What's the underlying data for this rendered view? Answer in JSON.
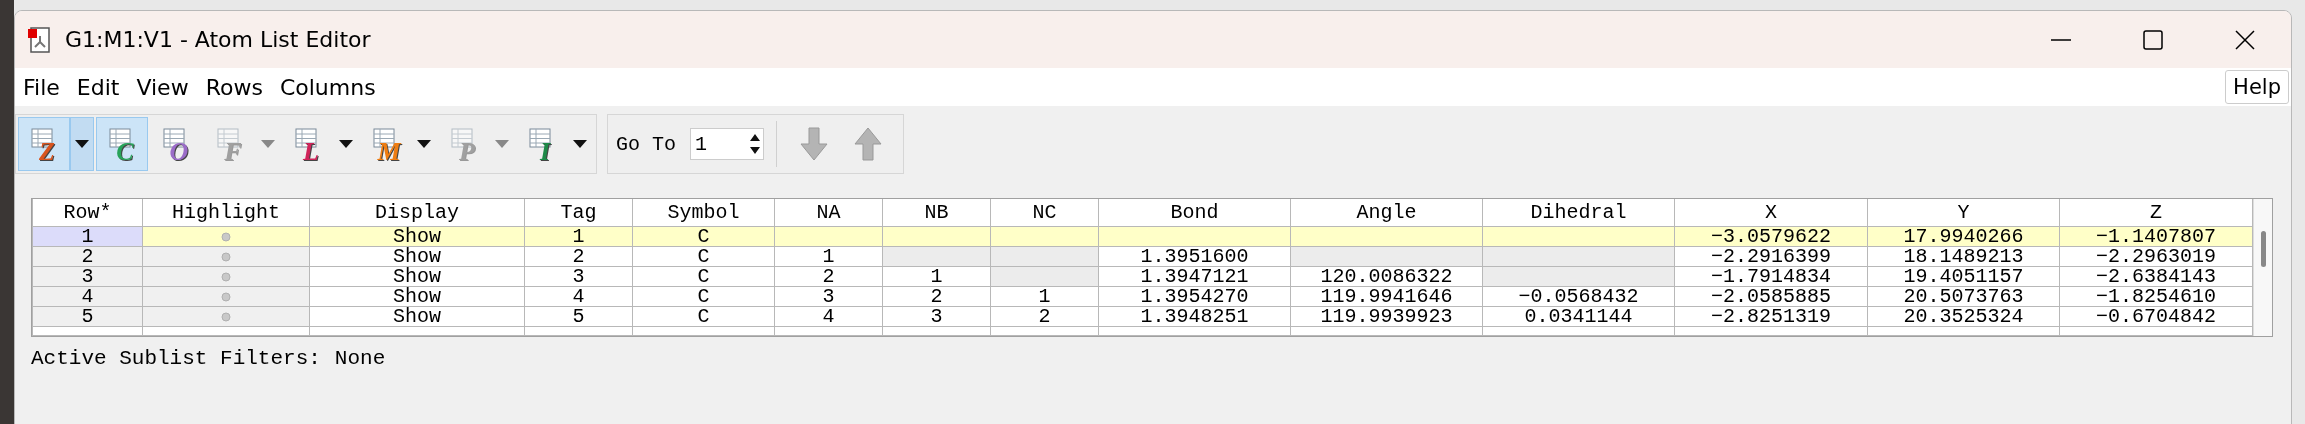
{
  "window": {
    "title": "G1:M1:V1 - Atom List Editor"
  },
  "menu": {
    "items": [
      "File",
      "Edit",
      "View",
      "Rows",
      "Columns"
    ],
    "help": "Help"
  },
  "toolbar": {
    "buttons": [
      {
        "letter": "Z",
        "color": "#d9541e",
        "selected": true,
        "disabled": false,
        "dropdown": true
      },
      {
        "letter": "C",
        "color": "#27a35a",
        "selected": true,
        "disabled": false,
        "dropdown": false
      },
      {
        "letter": "O",
        "color": "#9b6cc8",
        "selected": false,
        "disabled": false,
        "dropdown": false
      },
      {
        "letter": "F",
        "color": "#a0a0a0",
        "selected": false,
        "disabled": true,
        "dropdown": true
      },
      {
        "letter": "L",
        "color": "#d0245a",
        "selected": false,
        "disabled": false,
        "dropdown": true
      },
      {
        "letter": "M",
        "color": "#ee7d12",
        "selected": false,
        "disabled": false,
        "dropdown": true
      },
      {
        "letter": "P",
        "color": "#a0a0a0",
        "selected": false,
        "disabled": true,
        "dropdown": true
      },
      {
        "letter": "I",
        "color": "#1e8a48",
        "selected": false,
        "disabled": false,
        "dropdown": true
      }
    ],
    "goto_label": "Go To",
    "goto_value": "1"
  },
  "table": {
    "columns": [
      "Row*",
      "Highlight",
      "Display",
      "Tag",
      "Symbol",
      "NA",
      "NB",
      "NC",
      "Bond",
      "Angle",
      "Dihedral",
      "X",
      "Y",
      "Z"
    ],
    "rows": [
      {
        "selected": true,
        "cells": [
          "1",
          null,
          "Show",
          "1",
          "C",
          null,
          null,
          null,
          null,
          null,
          null,
          "−3.0579622",
          "17.9940266",
          "−1.1407807"
        ]
      },
      {
        "selected": false,
        "cells": [
          "2",
          null,
          "Show",
          "2",
          "C",
          "1",
          {
            "shaded": true
          },
          {
            "shaded": true
          },
          "1.3951600",
          {
            "shaded": true
          },
          {
            "shaded": true
          },
          "−2.2916399",
          "18.1489213",
          "−2.2963019"
        ]
      },
      {
        "selected": false,
        "cells": [
          "3",
          null,
          "Show",
          "3",
          "C",
          "2",
          "1",
          {
            "shaded": true
          },
          "1.3947121",
          "120.0086322",
          {
            "shaded": true
          },
          "−1.7914834",
          "19.4051157",
          "−2.6384143"
        ]
      },
      {
        "selected": false,
        "cells": [
          "4",
          null,
          "Show",
          "4",
          "C",
          "3",
          "2",
          "1",
          "1.3954270",
          "119.9941646",
          "−0.0568432",
          "−2.0585885",
          "20.5073763",
          "−1.8254610"
        ]
      },
      {
        "selected": false,
        "cells": [
          "5",
          null,
          "Show",
          "5",
          "C",
          "4",
          "3",
          "2",
          "1.3948251",
          "119.9939923",
          "0.0341144",
          "−2.8251319",
          "20.3525324",
          "−0.6704842"
        ]
      }
    ]
  },
  "status": {
    "label": "Active Sublist Filters:",
    "value": "None"
  }
}
